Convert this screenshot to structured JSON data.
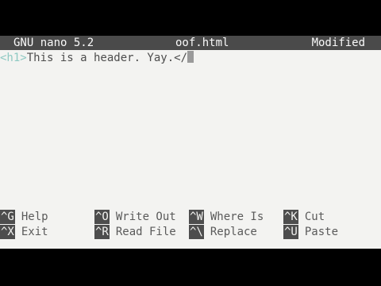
{
  "titlebar": {
    "app": "GNU nano 5.2",
    "filename": "oof.html",
    "status": "Modified"
  },
  "editor": {
    "line1_tag": "<h1>",
    "line1_text": "This is a header. Yay.</"
  },
  "shortcuts": [
    {
      "key": "^G",
      "label": "Help"
    },
    {
      "key": "^O",
      "label": "Write Out"
    },
    {
      "key": "^W",
      "label": "Where Is"
    },
    {
      "key": "^K",
      "label": "Cut"
    },
    {
      "key": "^X",
      "label": "Exit"
    },
    {
      "key": "^R",
      "label": "Read File"
    },
    {
      "key": "^\\",
      "label": "Replace"
    },
    {
      "key": "^U",
      "label": "Paste"
    }
  ],
  "colors": {
    "titlebar_bg": "#4a4a4a",
    "editor_bg": "#f3f3f1",
    "tag_color": "#8ec9c2"
  }
}
